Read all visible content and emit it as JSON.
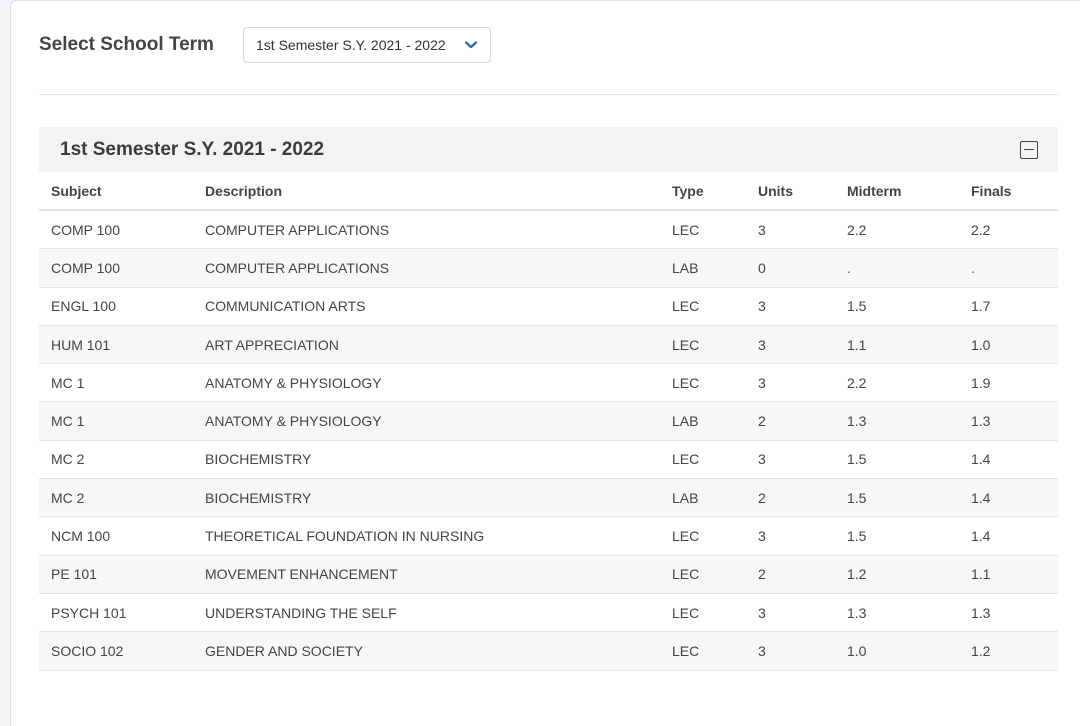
{
  "term_selector": {
    "label": "Select School Term",
    "selected": "1st Semester S.Y. 2021 - 2022"
  },
  "panel": {
    "title": "1st Semester S.Y. 2021 - 2022",
    "columns": [
      "Subject",
      "Description",
      "Type",
      "Units",
      "Midterm",
      "Finals"
    ],
    "rows": [
      [
        "COMP 100",
        "COMPUTER APPLICATIONS",
        "LEC",
        "3",
        "2.2",
        "2.2"
      ],
      [
        "COMP 100",
        "COMPUTER APPLICATIONS",
        "LAB",
        "0",
        ".",
        "."
      ],
      [
        "ENGL 100",
        "COMMUNICATION ARTS",
        "LEC",
        "3",
        "1.5",
        "1.7"
      ],
      [
        "HUM 101",
        "ART APPRECIATION",
        "LEC",
        "3",
        "1.1",
        "1.0"
      ],
      [
        "MC 1",
        "ANATOMY & PHYSIOLOGY",
        "LEC",
        "3",
        "2.2",
        "1.9"
      ],
      [
        "MC 1",
        "ANATOMY & PHYSIOLOGY",
        "LAB",
        "2",
        "1.3",
        "1.3"
      ],
      [
        "MC 2",
        "BIOCHEMISTRY",
        "LEC",
        "3",
        "1.5",
        "1.4"
      ],
      [
        "MC 2",
        "BIOCHEMISTRY",
        "LAB",
        "2",
        "1.5",
        "1.4"
      ],
      [
        "NCM 100",
        "THEORETICAL FOUNDATION IN NURSING",
        "LEC",
        "3",
        "1.5",
        "1.4"
      ],
      [
        "PE 101",
        "MOVEMENT ENHANCEMENT",
        "LEC",
        "2",
        "1.2",
        "1.1"
      ],
      [
        "PSYCH 101",
        "UNDERSTANDING THE SELF",
        "LEC",
        "3",
        "1.3",
        "1.3"
      ],
      [
        "SOCIO 102",
        "GENDER AND SOCIETY",
        "LEC",
        "3",
        "1.0",
        "1.2"
      ]
    ]
  },
  "icons": {
    "dropdown": "chevron-down-icon",
    "collapse": "minus-square-icon"
  },
  "colors": {
    "accent": "#2f6f9f",
    "header_bg": "#f2f3f4"
  }
}
